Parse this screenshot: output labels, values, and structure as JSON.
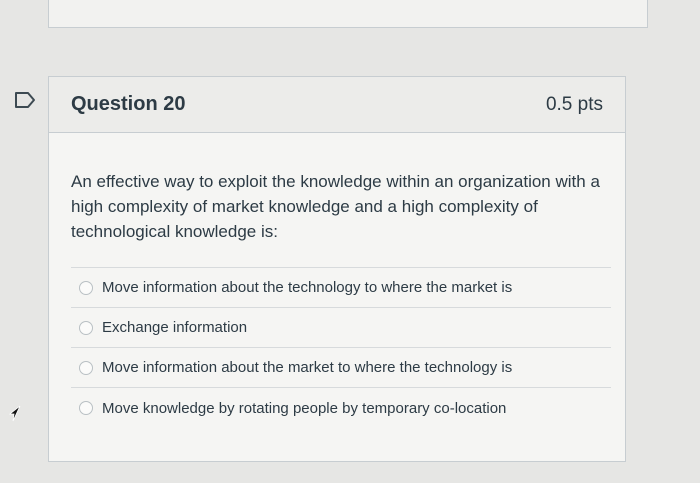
{
  "question": {
    "title": "Question 20",
    "points": "0.5 pts",
    "text": "An effective way to exploit the knowledge within an organization with a high complexity of market knowledge and a high complexity of technological knowledge is:",
    "answers": [
      {
        "label": "Move information about the technology to where the market is",
        "selected": false
      },
      {
        "label": "Exchange information",
        "selected": false
      },
      {
        "label": "Move information about the market to where the technology is",
        "selected": false
      },
      {
        "label": "Move knowledge by rotating people by temporary co-location",
        "selected": false
      }
    ]
  },
  "icons": {
    "flag": "bookmark-flag-icon",
    "cursor": "mouse-pointer-icon"
  },
  "colors": {
    "text": "#2d3b45",
    "border": "#c7cdd1",
    "background": "#e6e6e4"
  }
}
